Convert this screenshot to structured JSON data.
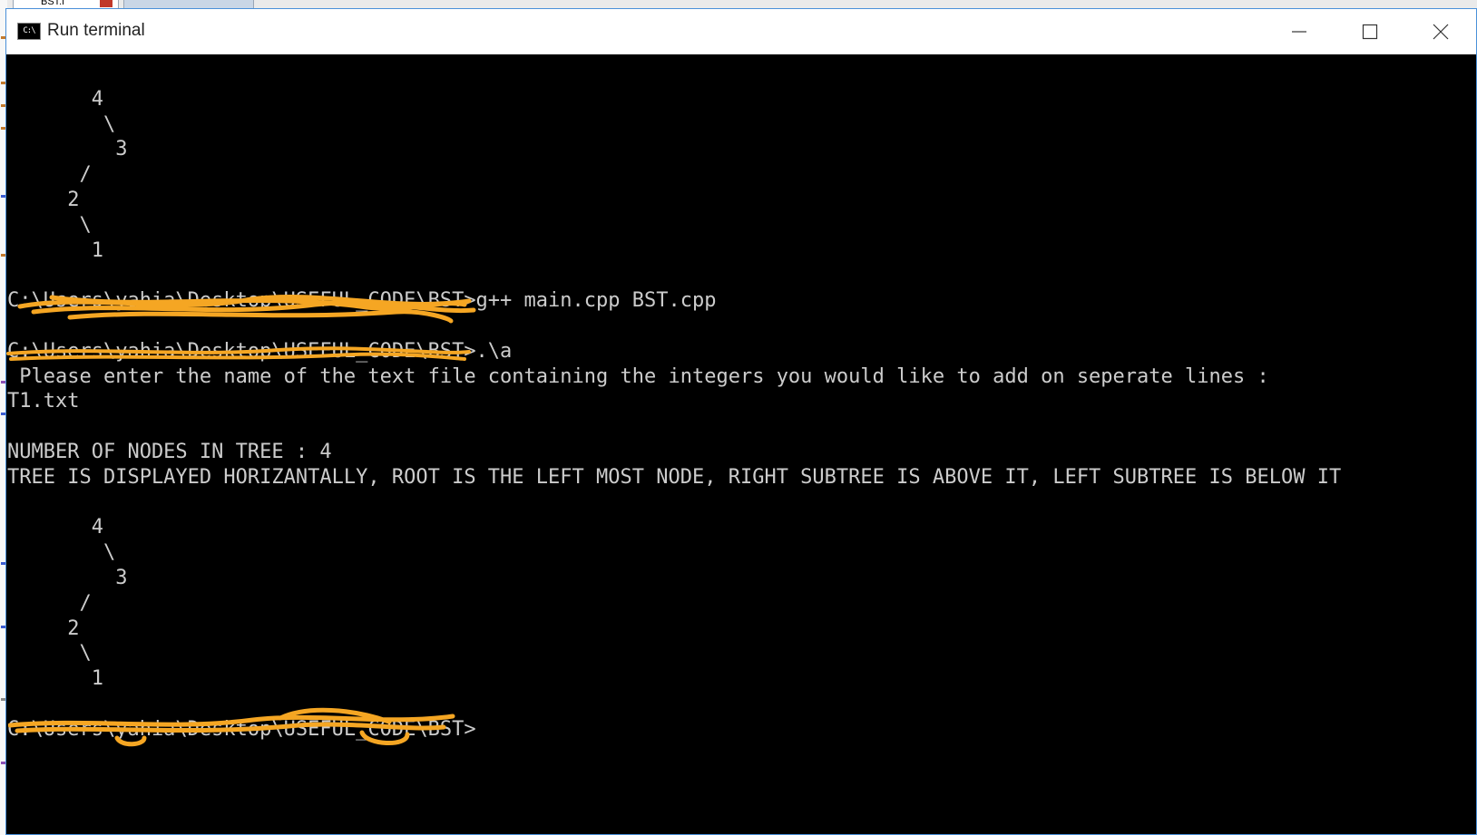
{
  "window": {
    "title": "Run terminal",
    "icon_label": "C:\\",
    "icons": [
      "minimize-icon",
      "maximize-icon",
      "close-icon"
    ]
  },
  "console": {
    "lines": [
      "",
      "       4",
      "        \\",
      "         3",
      "      /",
      "     2",
      "      \\",
      "       1",
      "",
      "C:\\Users\\yahia\\Desktop\\USEFUL_CODE\\BST>g++ main.cpp BST.cpp",
      "",
      "C:\\Users\\yahia\\Desktop\\USEFUL_CODE\\BST>.\\a",
      " Please enter the name of the text file containing the integers you would like to add on seperate lines :",
      "T1.txt",
      "",
      "NUMBER OF NODES IN TREE : 4",
      "TREE IS DISPLAYED HORIZANTALLY, ROOT IS THE LEFT MOST NODE, RIGHT SUBTREE IS ABOVE IT, LEFT SUBTREE IS BELOW IT",
      "",
      "       4",
      "        \\",
      "         3",
      "      /",
      "     2",
      "      \\",
      "       1",
      "",
      "C:\\Users\\yahia\\Desktop\\USEFUL_CODE\\BST>"
    ]
  },
  "background_app": {
    "tab_label": "BST.l"
  },
  "colors": {
    "console_bg": "#000000",
    "console_text": "#cccccc",
    "redaction": "#f5a623",
    "titlebar_bg": "#ffffff"
  }
}
